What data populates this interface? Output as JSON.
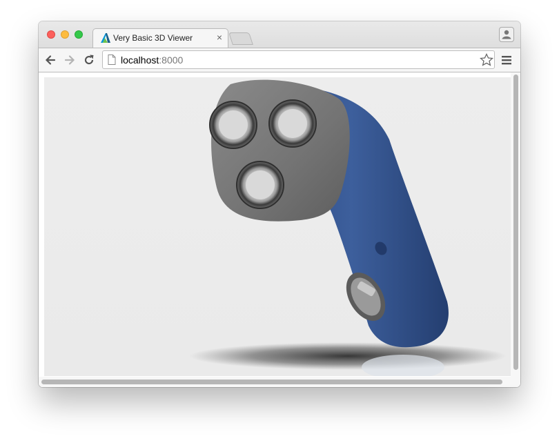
{
  "window": {
    "tab_title": "Very Basic 3D Viewer",
    "tab_close": "×"
  },
  "toolbar": {
    "url_host": "localhost",
    "url_port": ":8000"
  },
  "colors": {
    "shaver_body": "#3b5a93",
    "shaver_head": "#7c7c7c",
    "viewer_bg": "#ececec",
    "traffic_close": "#fc605c",
    "traffic_min": "#fdbc40",
    "traffic_max": "#34c84a"
  },
  "icons": {
    "app": "autodesk-logo-icon",
    "back": "back-arrow-icon",
    "forward": "forward-arrow-icon",
    "reload": "reload-icon",
    "page": "page-icon",
    "bookmark": "star-icon",
    "menu": "hamburger-menu-icon",
    "profile": "user-profile-icon"
  },
  "viewer": {
    "model": "electric shaver"
  }
}
